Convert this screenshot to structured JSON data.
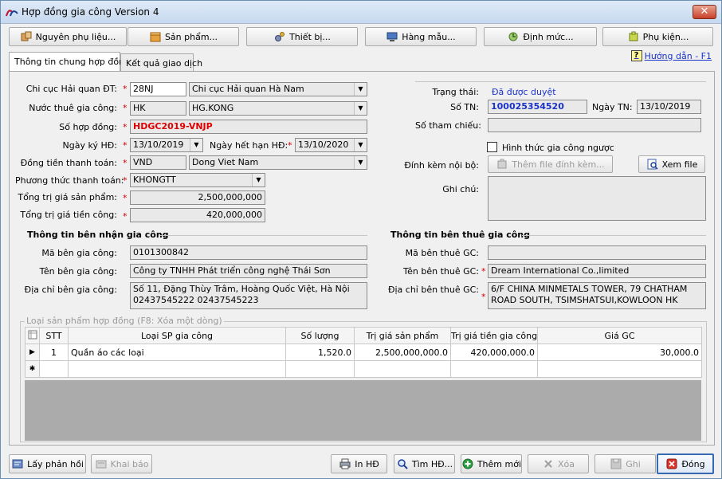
{
  "window": {
    "title": "Hợp đồng gia công Version 4",
    "close_label": "✕"
  },
  "toolbar": [
    {
      "label": "Nguyên phụ liệu...",
      "icon": "materials-icon"
    },
    {
      "label": "Sản phẩm...",
      "icon": "product-icon"
    },
    {
      "label": "Thiết bị...",
      "icon": "equipment-icon"
    },
    {
      "label": "Hàng mẫu...",
      "icon": "sample-icon"
    },
    {
      "label": "Định mức...",
      "icon": "norm-icon"
    },
    {
      "label": "Phụ kiện...",
      "icon": "accessory-icon"
    }
  ],
  "tabs": [
    {
      "label": "Thông tin chung hợp đồng",
      "active": true
    },
    {
      "label": "Kết quả giao dịch",
      "active": false
    }
  ],
  "help": {
    "label": "Hướng dẫn - F1",
    "icon_glyph": "?"
  },
  "form": {
    "customs_branch": {
      "label": "Chi cục Hải quan ĐT:",
      "code": "28NJ",
      "name": "Chi cục Hải quan Hà Nam"
    },
    "outsourcing_country": {
      "label": "Nước thuê gia công:",
      "code": "HK",
      "name": "HG.KONG"
    },
    "contract_no": {
      "label": "Số hợp đồng:",
      "value": "HDGC2019-VNJP"
    },
    "sign_date": {
      "label": "Ngày ký HĐ:",
      "value": "13/10/2019"
    },
    "expiry_date": {
      "label": "Ngày hết hạn HĐ:",
      "value": "13/10/2020"
    },
    "currency": {
      "label": "Đồng tiền thanh toán:",
      "code": "VND",
      "name": "Dong Viet Nam"
    },
    "payment_method": {
      "label": "Phương thức thanh toán:",
      "value": "KHONGTT"
    },
    "total_product_value": {
      "label": "Tổng trị giá sản phẩm:",
      "value": "2,500,000,000"
    },
    "total_processing_value": {
      "label": "Tổng trị giá tiền công:",
      "value": "420,000,000"
    },
    "required_mark": "*"
  },
  "status": {
    "state_label": "Trạng thái:",
    "state_value": "Đã được duyệt",
    "tn_label": "Số TN:",
    "tn_value": "100025354520",
    "tn_date_label": "Ngày TN:",
    "tn_date_value": "13/10/2019",
    "ref_label": "Số tham chiếu:",
    "ref_value": "",
    "reverse_label": "Hình thức gia công ngược",
    "attach_label": "Đính kèm nội bộ:",
    "attach_button": "Thêm file đính kèm...",
    "view_button": "Xem file",
    "note_label": "Ghi chú:",
    "note_value": ""
  },
  "receiver": {
    "title": "Thông tin bên nhận gia công",
    "code_label": "Mã bên gia công:",
    "code_value": "0101300842",
    "name_label": "Tên bên gia công:",
    "name_value": "Công ty TNHH Phát triển công nghệ Thái Sơn",
    "address_label": "Địa chỉ bên gia công:",
    "address_value": "Số 11, Đặng Thùy Trâm, Hoàng Quốc Việt, Hà Nội 02437545222  02437545223"
  },
  "hirer": {
    "title": "Thông tin bên thuê gia công",
    "code_label": "Mã bên thuê GC:",
    "code_value": "",
    "name_label": "Tên bên thuê GC:",
    "name_value": "Dream International Co.,limited",
    "address_label": "Địa chỉ bên thuê GC:",
    "address_value": "6/F CHINA MINMETALS TOWER, 79 CHATHAM ROAD SOUTH, TSIMSHATSUI,KOWLOON HK"
  },
  "products": {
    "group_title": "Loại sản phẩm hợp đồng (F8: Xóa một dòng)",
    "columns": [
      "STT",
      "Loại SP gia công",
      "Số lượng",
      "Trị giá sản phẩm",
      "Trị giá tiền gia công",
      "Giá GC"
    ],
    "rows": [
      {
        "stt": "1",
        "type": "Quần áo các loại",
        "qty": "1,520.0",
        "product_value": "2,500,000,000.0",
        "processing_value": "420,000,000.0",
        "unit_price": "30,000.0"
      }
    ],
    "current_row_marker": "▶",
    "new_row_marker": "✱"
  },
  "footer": {
    "get_response": "Lấy phản hồi",
    "declare": "Khai báo",
    "print": "In HĐ",
    "find": "Tìm HĐ...",
    "add_new": "Thêm mới",
    "delete": "Xóa",
    "save": "Ghi",
    "close": "Đóng"
  },
  "colors": {
    "required": "#d40000",
    "status_blue": "#1a33c8",
    "contract_red": "#e00000"
  }
}
